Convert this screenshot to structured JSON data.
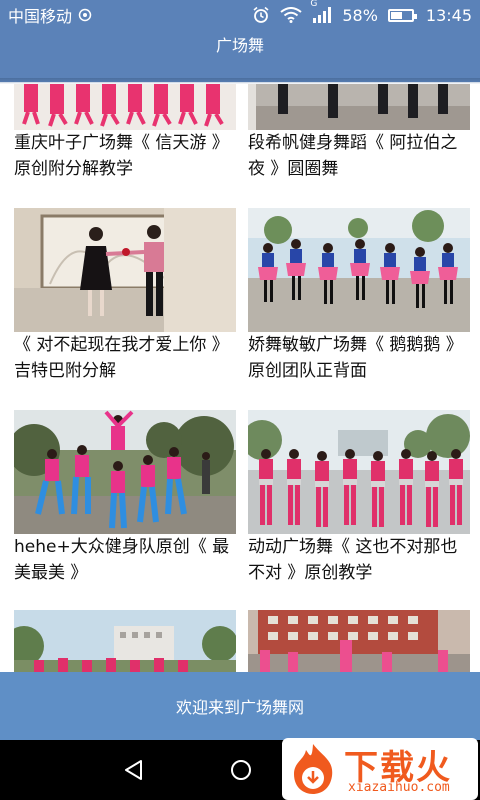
{
  "status_bar": {
    "carrier": "中国移动",
    "signal_label": "G",
    "battery": "58%",
    "battery_level": 0.58,
    "time": "13:45"
  },
  "app_bar": {
    "title": "广场舞"
  },
  "videos": [
    {
      "title": "重庆叶子广场舞《 信天游 》原创附分解教学"
    },
    {
      "title": "段希帆健身舞蹈《 阿拉伯之夜 》圆圈舞"
    },
    {
      "title": "《 对不起现在我才爱上你 》吉特巴附分解"
    },
    {
      "title": "娇舞敏敏广场舞《 鹅鹅鹅 》原创团队正背面"
    },
    {
      "title": "hehe+大众健身队原创《 最美最美 》"
    },
    {
      "title": "动动广场舞《 这也不对那也不对 》原创教学"
    },
    {
      "title": ""
    },
    {
      "title": ""
    }
  ],
  "banner": {
    "text": "欢迎来到广场舞网"
  },
  "watermark": {
    "brand": "下载火",
    "domain": "xiazaihuo.com"
  },
  "colors": {
    "primary": "#5b82b8",
    "banner": "#5f8fc6",
    "watermark": "#f05a1e"
  }
}
